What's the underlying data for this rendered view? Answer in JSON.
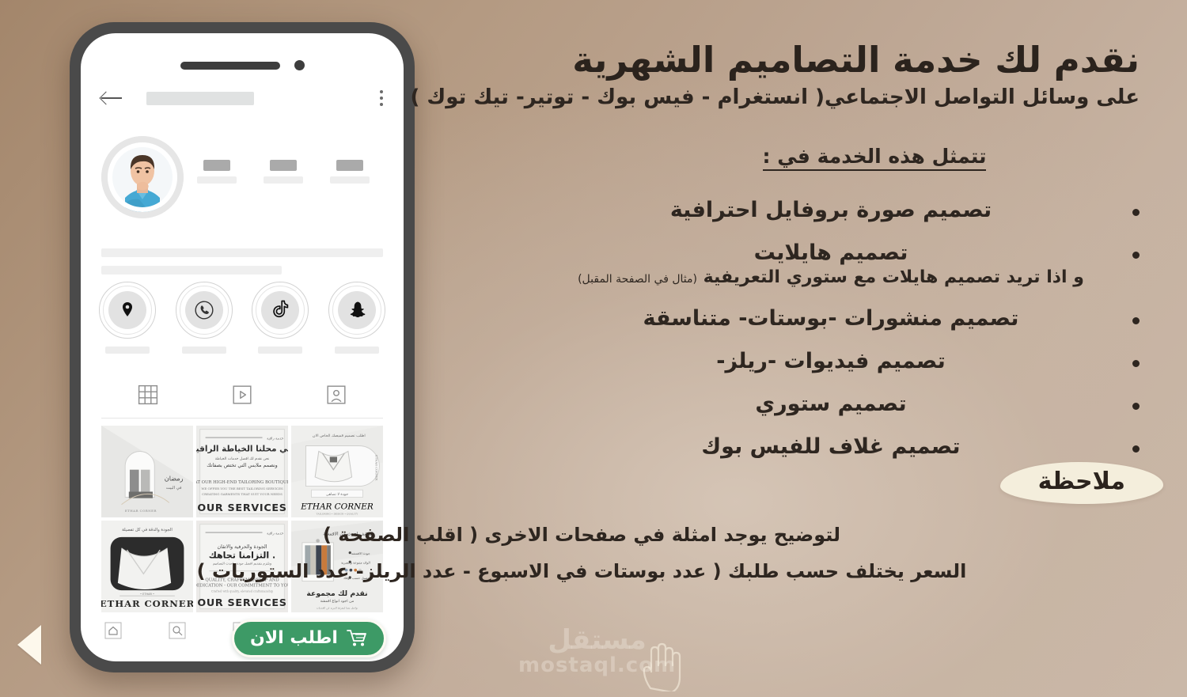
{
  "slide": {
    "background_color": "#b49a82",
    "accent_cream": "#f4eedc",
    "accent_green": "#3d9a66",
    "text_color": "#2e2620"
  },
  "nav": {
    "prev_arrow_label": "prev-slide"
  },
  "headline": "نقدم لك خدمة التصاميم الشهرية",
  "subhead": "على وسائل التواصل الاجتماعي( انستغرام - فيس بوك - توتير- تيك توك )",
  "section_title": "تتمثل هذه الخدمة في :",
  "bullets": [
    {
      "text": "تصميم صورة بروفايل احترافية"
    },
    {
      "text": "تصميم هايلايت",
      "sub": "و اذا تريد تصميم هايلات مع ستوري التعريفية",
      "sub_paren": "(مثال في الصفحة المقبل)"
    },
    {
      "text": "تصميم منشورات -بوستات- متناسقة"
    },
    {
      "text": "تصميم فيديوات -ريلز-"
    },
    {
      "text": "تصميم ستوري"
    },
    {
      "text": "تصميم غلاف للفيس بوك"
    }
  ],
  "note_badge": "ملاحظة",
  "footnotes": [
    "لتوضيح يوجد امثلة في صفحات الاخرى ( اقلب الصفحة )",
    "السعر يختلف حسب طلبك ( عدد بوستات في الاسبوع - عدد الريلز- عدد الستوريات )"
  ],
  "order_button": {
    "label": "اطلب الان",
    "icon": "shopping-cart-icon"
  },
  "watermark": {
    "line1": "مستقل",
    "line2": "mostaql.com"
  },
  "phone": {
    "appbar": {
      "back_icon": "back-arrow-icon",
      "menu_icon": "kebab-menu-icon"
    },
    "profile": {
      "avatar": "user-avatar",
      "stats": [
        {
          "value": "",
          "label": ""
        },
        {
          "value": "",
          "label": ""
        },
        {
          "value": "",
          "label": ""
        }
      ]
    },
    "highlights": [
      {
        "icon": "location-pin-icon",
        "label": ""
      },
      {
        "icon": "phone-icon",
        "label": ""
      },
      {
        "icon": "tiktok-icon",
        "label": ""
      },
      {
        "icon": "snapchat-icon",
        "label": ""
      }
    ],
    "tabs": [
      {
        "icon": "grid-tab-icon"
      },
      {
        "icon": "reels-tab-icon"
      },
      {
        "icon": "tagged-tab-icon"
      }
    ],
    "posts": [
      {
        "caption": "ETHAR CORNER",
        "kind": "interior-arch"
      },
      {
        "caption": "OUR SERVICES",
        "kind": "tailoring-text"
      },
      {
        "caption": "ETHAR CORNER",
        "kind": "shirt-collar"
      },
      {
        "caption": "ETHAR CORNER",
        "kind": "shirt-dark"
      },
      {
        "caption": "OUR SERVICES",
        "kind": "quality-text"
      },
      {
        "caption": "",
        "kind": "fabric-swatches"
      }
    ],
    "bottom_nav": [
      {
        "icon": "home-icon"
      },
      {
        "icon": "search-icon"
      },
      {
        "icon": "add-post-icon"
      },
      {
        "icon": "reels-icon"
      },
      {
        "icon": "profile-icon"
      }
    ]
  }
}
